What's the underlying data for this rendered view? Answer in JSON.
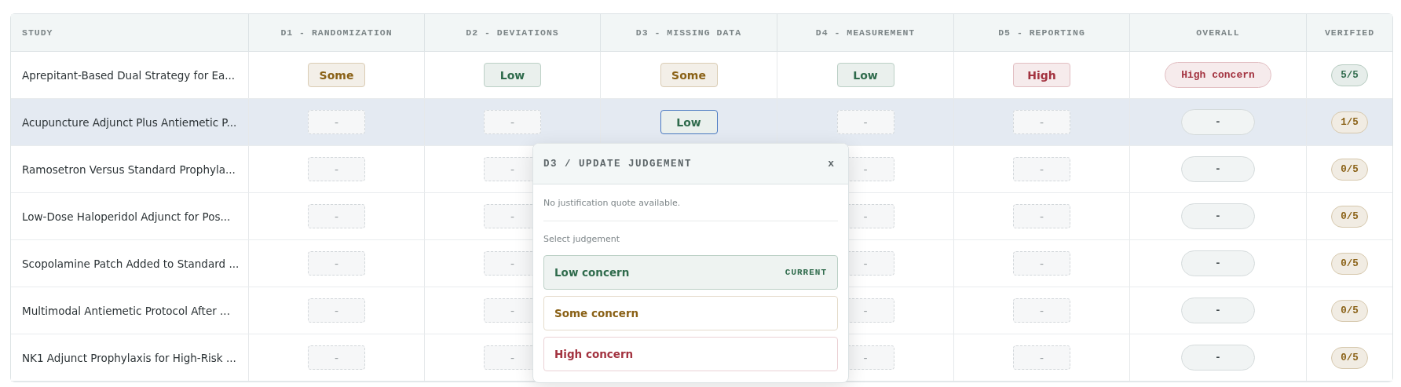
{
  "table": {
    "columns": [
      "STUDY",
      "D1 - RANDOMIZATION",
      "D2 - DEVIATIONS",
      "D3 - MISSING DATA",
      "D4 - MEASUREMENT",
      "D5 - REPORTING",
      "OVERALL",
      "VERIFIED"
    ],
    "rows": [
      {
        "study": "Aprepitant-Based Dual Strategy for Ea...",
        "selected": false,
        "d1": {
          "text": "Some",
          "kind": "rated",
          "color": "#8a6116",
          "editing": false
        },
        "d2": {
          "text": "Low",
          "kind": "rated",
          "color": "#2f6b4c",
          "editing": false
        },
        "d3": {
          "text": "Some",
          "kind": "rated",
          "color": "#8a6116",
          "editing": false
        },
        "d4": {
          "text": "Low",
          "kind": "rated",
          "color": "#2f6b4c",
          "editing": false
        },
        "d5": {
          "text": "High",
          "kind": "rated",
          "color": "#a33340",
          "editing": false
        },
        "overall": {
          "text": "High concern",
          "kind": "rated",
          "color": "#a33340"
        },
        "verified": {
          "text": "5/5",
          "color": "#2f6b4c"
        }
      },
      {
        "study": "Acupuncture Adjunct Plus Antiemetic P...",
        "selected": true,
        "d1": {
          "text": "-",
          "kind": "empty",
          "editing": false
        },
        "d2": {
          "text": "-",
          "kind": "empty",
          "editing": false
        },
        "d3": {
          "text": "Low",
          "kind": "rated",
          "color": "#2f6b4c",
          "editing": true
        },
        "d4": {
          "text": "-",
          "kind": "empty",
          "editing": false
        },
        "d5": {
          "text": "-",
          "kind": "empty",
          "editing": false
        },
        "overall": {
          "text": "-",
          "kind": "empty"
        },
        "verified": {
          "text": "1/5",
          "color": "#8a6116"
        }
      },
      {
        "study": "Ramosetron Versus Standard Prophyla...",
        "selected": false,
        "d1": {
          "text": "-",
          "kind": "empty",
          "editing": false
        },
        "d2": {
          "text": "-",
          "kind": "empty",
          "editing": false
        },
        "d4": {
          "text": "-",
          "kind": "empty",
          "editing": false
        },
        "d5": {
          "text": "-",
          "kind": "empty",
          "editing": false
        },
        "overall": {
          "text": "-",
          "kind": "empty"
        },
        "verified": {
          "text": "0/5",
          "color": "#8a6116"
        }
      },
      {
        "study": "Low-Dose Haloperidol Adjunct for Pos...",
        "selected": false,
        "d1": {
          "text": "-",
          "kind": "empty",
          "editing": false
        },
        "d2": {
          "text": "-",
          "kind": "empty",
          "editing": false
        },
        "d4": {
          "text": "-",
          "kind": "empty",
          "editing": false
        },
        "d5": {
          "text": "-",
          "kind": "empty",
          "editing": false
        },
        "overall": {
          "text": "-",
          "kind": "empty"
        },
        "verified": {
          "text": "0/5",
          "color": "#8a6116"
        }
      },
      {
        "study": "Scopolamine Patch Added to Standard ...",
        "selected": false,
        "d1": {
          "text": "-",
          "kind": "empty",
          "editing": false
        },
        "d2": {
          "text": "-",
          "kind": "empty",
          "editing": false
        },
        "d4": {
          "text": "-",
          "kind": "empty",
          "editing": false
        },
        "d5": {
          "text": "-",
          "kind": "empty",
          "editing": false
        },
        "overall": {
          "text": "-",
          "kind": "empty"
        },
        "verified": {
          "text": "0/5",
          "color": "#8a6116"
        }
      },
      {
        "study": "Multimodal Antiemetic Protocol After ...",
        "selected": false,
        "d1": {
          "text": "-",
          "kind": "empty",
          "editing": false
        },
        "d2": {
          "text": "-",
          "kind": "empty",
          "editing": false
        },
        "d4": {
          "text": "-",
          "kind": "empty",
          "editing": false
        },
        "d5": {
          "text": "-",
          "kind": "empty",
          "editing": false
        },
        "overall": {
          "text": "-",
          "kind": "empty"
        },
        "verified": {
          "text": "0/5",
          "color": "#8a6116"
        }
      },
      {
        "study": "NK1 Adjunct Prophylaxis for High-Risk ...",
        "selected": false,
        "d1": {
          "text": "-",
          "kind": "empty",
          "editing": false
        },
        "d2": {
          "text": "-",
          "kind": "empty",
          "editing": false
        },
        "d4": {
          "text": "-",
          "kind": "empty",
          "editing": false
        },
        "d5": {
          "text": "-",
          "kind": "empty",
          "editing": false
        },
        "overall": {
          "text": "-",
          "kind": "empty"
        },
        "verified": {
          "text": "0/5",
          "color": "#8a6116"
        }
      }
    ]
  },
  "popover": {
    "title": "D3 / UPDATE JUDGEMENT",
    "close": "x",
    "note": "No justification quote available.",
    "label": "Select judgement",
    "options": [
      {
        "label": "Low concern",
        "color": "#2f6b4c",
        "current": true,
        "tag": "CURRENT"
      },
      {
        "label": "Some concern",
        "color": "#8a6116",
        "current": false
      },
      {
        "label": "High concern",
        "color": "#a33340",
        "current": false
      }
    ]
  }
}
